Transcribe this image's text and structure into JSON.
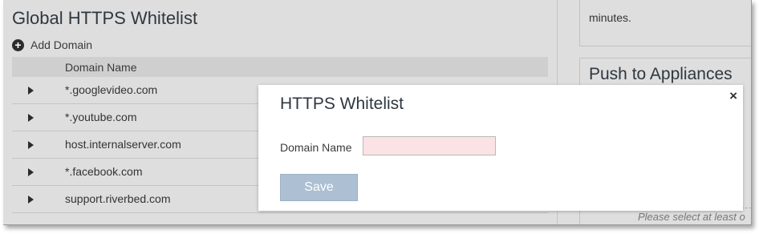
{
  "left_panel": {
    "title": "Global HTTPS Whitelist",
    "add_label": "Add Domain",
    "table": {
      "header": "Domain Name",
      "rows": [
        "*.googlevideo.com",
        "*.youtube.com",
        "host.internalserver.com",
        "*.facebook.com",
        "support.riverbed.com"
      ]
    }
  },
  "right_panel": {
    "box1_text": "minutes.",
    "box2_title": "Push to Appliances",
    "box2_hint": "Please select at least o"
  },
  "modal": {
    "title": "HTTPS Whitelist",
    "close": "×",
    "field_label": "Domain Name",
    "field_value": "",
    "save_label": "Save"
  },
  "colors": {
    "input_bg": "#fbe3e5",
    "save_bg": "#adbfd2"
  },
  "icons": [
    "plus-circle-icon",
    "expand-caret-icon",
    "close-icon"
  ]
}
